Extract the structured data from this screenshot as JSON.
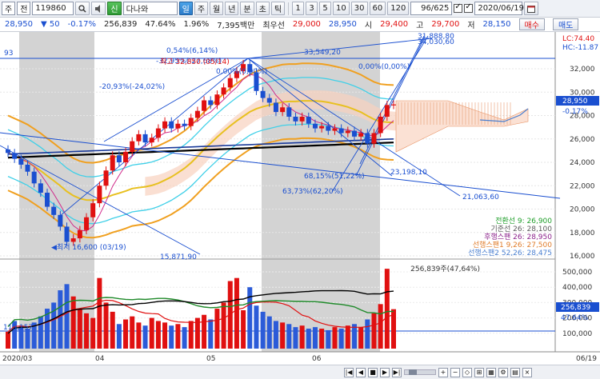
{
  "toolbar": {
    "first_select": "주",
    "whole_select": "전",
    "code": "119860",
    "search_icon": "search-icon",
    "sound_icon": "speaker-icon",
    "badge_sin": "신",
    "stock_name": "다나와",
    "badge_il": "일",
    "periods": [
      "주",
      "월",
      "년",
      "분",
      "초",
      "틱"
    ],
    "intervals": [
      "1",
      "3",
      "5",
      "10",
      "30",
      "60",
      "120"
    ],
    "counter": "96/625",
    "checks": [
      true,
      true
    ],
    "date": "2020/06/19"
  },
  "infobar": {
    "price": "28,950",
    "change": "50",
    "change_pct": "-0.17%",
    "volume": "256,839",
    "turnover_pct": "47.64%",
    "vol_ratio": "1.96%",
    "amount": "7,395백만",
    "open_label": "최우선",
    "open_val": "29,000",
    "ask_val": "28,950",
    "start_label": "시",
    "start_val": "29,400",
    "high_label": "고",
    "high_val": "29,700",
    "low_label": "저",
    "low_val": "28,150",
    "buy_button": "매수",
    "sell_button": "매도"
  },
  "chart": {
    "top_left_label": "93",
    "lc_label": "LC:74.40",
    "hc_label": "HC:-11.87",
    "last_price_tag": "28,950",
    "last_pct_tag": "-0.17%",
    "volume_tag": "256,839",
    "volume_pct_tag": "47.64%",
    "volume_header": "256,839주(47,64%)",
    "price_axis": [
      "32,000",
      "30,000",
      "28,000",
      "26,000",
      "24,000",
      "22,000",
      "20,000",
      "18,000",
      "16,000"
    ],
    "volume_axis": [
      "500,000",
      "400,000",
      "300,000",
      "200,000",
      "100,000"
    ],
    "date_axis": [
      "2020/03",
      "04",
      "05",
      "06"
    ],
    "date_axis_right": "06/19",
    "vol_left_label": "115,157",
    "annotations": {
      "high": "최고 32,850 (05/14)",
      "low": "◀최저 16,600 (03/19)",
      "a1": "-32,95%(-27,68%)",
      "a2": "0,54%(6,14%)",
      "a3": "-20,93%(-24,02%)",
      "a4": "0,00%(0,00%)",
      "a5": "33,549,20",
      "a6": "0,00%(0,00%)",
      "a7": "31,888,80",
      "a8": "34,030,60",
      "a9": "68,15%(51,22%)",
      "a10": "63,73%(62,20%)",
      "a11": "23,198,10",
      "a12": "21,063,60",
      "a13": "15,871,90"
    },
    "legend": [
      {
        "text": "전환선 9: 26,900",
        "color": "#1f9e2a"
      },
      {
        "text": "기준선 26: 28,100",
        "color": "#5a5a5a"
      },
      {
        "text": "후행스팬 26: 28,950",
        "color": "#8a1f8a"
      },
      {
        "text": "선행스팬1 9,26: 27,500",
        "color": "#e07c2a"
      },
      {
        "text": "선행스팬2 52,26: 28,475",
        "color": "#4a7fd0"
      }
    ]
  },
  "chart_data": {
    "type": "candlestick",
    "price_axis_range": [
      15500,
      33500
    ],
    "volume_axis_range": [
      0,
      550000
    ],
    "last_price": 28950,
    "last_volume": 256839,
    "high": {
      "value": 32850,
      "date": "05/14"
    },
    "low": {
      "value": 16600,
      "date": "03/19"
    },
    "closes": [
      24800,
      24300,
      23800,
      23200,
      22200,
      21400,
      20200,
      19500,
      18500,
      17200,
      17500,
      18200,
      19300,
      20500,
      22000,
      23300,
      24600,
      24000,
      24900,
      25800,
      26400,
      25700,
      26100,
      26900,
      27500,
      26900,
      27300,
      27100,
      27800,
      28400,
      29300,
      28900,
      29800,
      30400,
      31200,
      31800,
      32400,
      31700,
      30100,
      29500,
      29100,
      28300,
      28700,
      27900,
      27500,
      27900,
      27300,
      26900,
      27100,
      26700,
      26900,
      26500,
      26700,
      26200,
      26500,
      25600,
      26500,
      27900,
      28900,
      28950
    ],
    "volumes": [
      110000,
      180000,
      150000,
      130000,
      170000,
      210000,
      260000,
      300000,
      380000,
      420000,
      340000,
      260000,
      230000,
      200000,
      460000,
      300000,
      240000,
      160000,
      190000,
      210000,
      170000,
      150000,
      200000,
      180000,
      170000,
      150000,
      160000,
      140000,
      180000,
      200000,
      220000,
      190000,
      260000,
      300000,
      440000,
      460000,
      250000,
      400000,
      280000,
      240000,
      210000,
      180000,
      170000,
      160000,
      140000,
      150000,
      130000,
      140000,
      130000,
      120000,
      140000,
      130000,
      150000,
      160000,
      140000,
      190000,
      230000,
      290000,
      520000,
      256839
    ]
  }
}
